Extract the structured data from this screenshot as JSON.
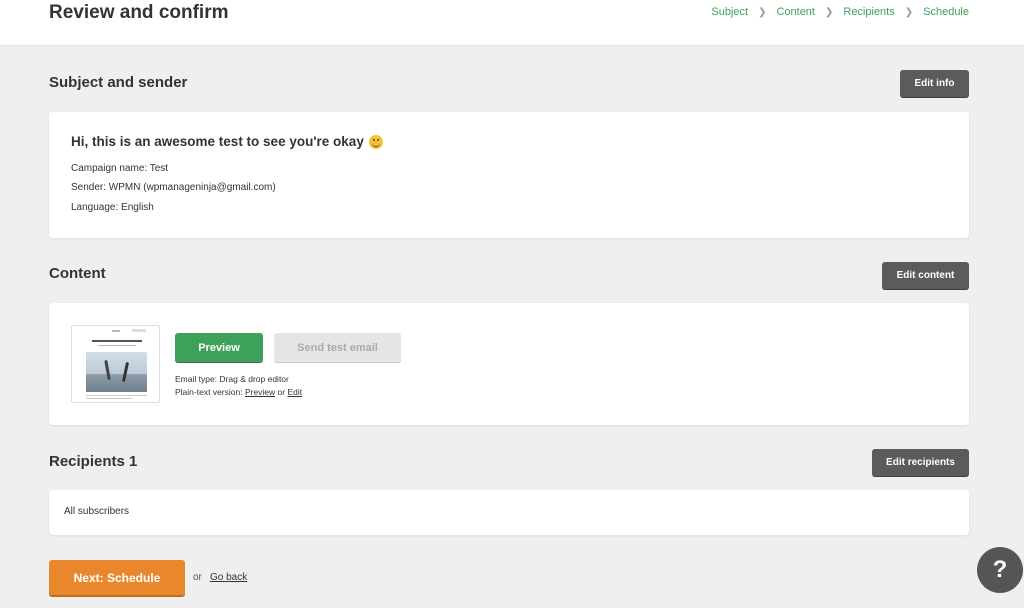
{
  "header": {
    "title": "Review and confirm",
    "steps": [
      "Subject",
      "Content",
      "Recipients",
      "Schedule"
    ]
  },
  "subject_section": {
    "title": "Subject and sender",
    "edit_label": "Edit info",
    "subject": "Hi, this is an awesome test to see you're okay",
    "emoji_icon": "grinning-face-icon",
    "campaign_name": "Campaign name: Test",
    "sender": "Sender: WPMN (wpmanageninja@gmail.com)",
    "language": "Language: English"
  },
  "content_section": {
    "title": "Content",
    "edit_label": "Edit content",
    "preview_label": "Preview",
    "send_test_label": "Send test email",
    "email_type": "Email type: Drag & drop editor",
    "plain_text_prefix": "Plain-text version:",
    "plain_preview_link": "Preview",
    "plain_or": "or",
    "plain_edit_link": "Edit"
  },
  "recipients_section": {
    "title": "Recipients 1",
    "edit_label": "Edit recipients",
    "value": "All subscribers"
  },
  "footer": {
    "next_label": "Next: Schedule",
    "or_text": "or",
    "go_back_label": "Go back"
  },
  "help": {
    "label": "?",
    "icon": "help-icon"
  },
  "colors": {
    "accent_green": "#3ea15a",
    "accent_orange": "#e8872c",
    "dark_button": "#5b5b5b"
  }
}
